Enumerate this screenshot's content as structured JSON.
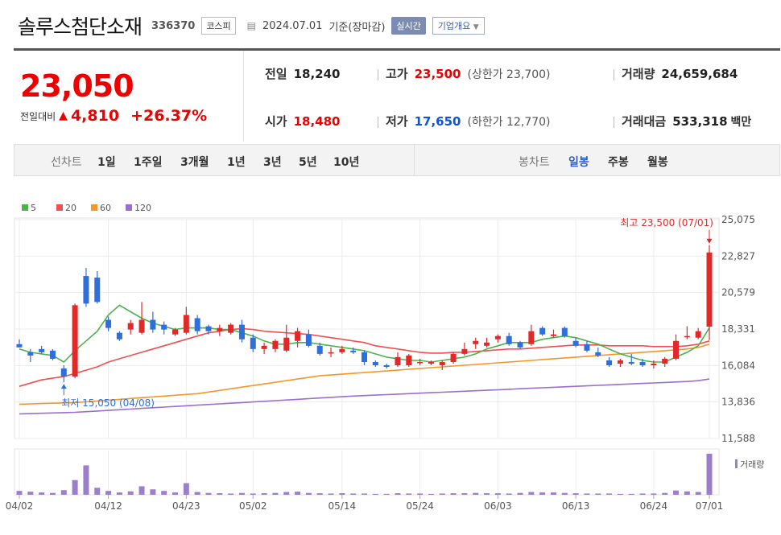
{
  "header": {
    "name": "솔루스첨단소재",
    "code": "336370",
    "market": "코스피",
    "date": "2024.07.01",
    "basis": "기준(장마감)",
    "realtime": "실시간",
    "corp_info": "기업개요"
  },
  "quote": {
    "price": "23,050",
    "change_label": "전일대비",
    "change": "4,810",
    "change_pct": "+26.37%",
    "prev_label": "전일",
    "prev": "18,240",
    "open_label": "시가",
    "open": "18,480",
    "high_label": "고가",
    "high": "23,500",
    "upper_limit": "(상한가 23,700)",
    "low_label": "저가",
    "low": "17,650",
    "lower_limit": "(하한가 12,770)",
    "volume_label": "거래량",
    "volume": "24,659,684",
    "amount_label": "거래대금",
    "amount": "533,318",
    "amount_unit": "백만"
  },
  "tabs": {
    "line_chart": "선차트",
    "periods": [
      "1일",
      "1주일",
      "3개월",
      "1년",
      "3년",
      "5년",
      "10년"
    ],
    "candle_chart": "봉차트",
    "candle_types": [
      "일봉",
      "주봉",
      "월봉"
    ]
  },
  "chart_data": {
    "type": "candlestick",
    "legend": [
      "5",
      "20",
      "60",
      "120"
    ],
    "legend_colors": [
      "#4cb34c",
      "#f05050",
      "#f5962a",
      "#9b6ed0"
    ],
    "y_ticks": [
      25075,
      22827,
      20579,
      18331,
      16084,
      13836,
      11588
    ],
    "ylim": [
      11588,
      25075
    ],
    "x_ticks": [
      "04/02",
      "04/12",
      "04/23",
      "05/02",
      "05/14",
      "05/24",
      "06/03",
      "06/13",
      "06/24",
      "07/01"
    ],
    "x_tick_index": [
      0,
      8,
      15,
      21,
      29,
      36,
      43,
      50,
      57,
      62
    ],
    "high_annotation": "최고 23,500 (07/01)",
    "low_annotation": "최저 15,050 (04/08)",
    "volume_label": "거래량",
    "candles": [
      {
        "o": 17400,
        "h": 17700,
        "l": 17200,
        "c": 17200
      },
      {
        "o": 16900,
        "h": 17100,
        "l": 16300,
        "c": 16700
      },
      {
        "o": 17100,
        "h": 17300,
        "l": 16800,
        "c": 16900
      },
      {
        "o": 17000,
        "h": 17100,
        "l": 16400,
        "c": 16500
      },
      {
        "o": 15900,
        "h": 16100,
        "l": 15050,
        "c": 15400
      },
      {
        "o": 15400,
        "h": 19900,
        "l": 15300,
        "c": 19800
      },
      {
        "o": 21600,
        "h": 22100,
        "l": 19700,
        "c": 19900
      },
      {
        "o": 21500,
        "h": 21900,
        "l": 19900,
        "c": 20000
      },
      {
        "o": 18900,
        "h": 19100,
        "l": 18200,
        "c": 18400
      },
      {
        "o": 18100,
        "h": 18200,
        "l": 17600,
        "c": 17700
      },
      {
        "o": 18300,
        "h": 18900,
        "l": 18000,
        "c": 18700
      },
      {
        "o": 18100,
        "h": 20000,
        "l": 18000,
        "c": 18900
      },
      {
        "o": 18900,
        "h": 19400,
        "l": 18100,
        "c": 18300
      },
      {
        "o": 18600,
        "h": 18800,
        "l": 18000,
        "c": 18300
      },
      {
        "o": 18000,
        "h": 18400,
        "l": 17900,
        "c": 18300
      },
      {
        "o": 18100,
        "h": 19700,
        "l": 18000,
        "c": 19200
      },
      {
        "o": 19000,
        "h": 19200,
        "l": 18000,
        "c": 18200
      },
      {
        "o": 18500,
        "h": 18600,
        "l": 18000,
        "c": 18200
      },
      {
        "o": 18200,
        "h": 18600,
        "l": 17900,
        "c": 18400
      },
      {
        "o": 18100,
        "h": 18700,
        "l": 18000,
        "c": 18600
      },
      {
        "o": 18600,
        "h": 18900,
        "l": 17500,
        "c": 17700
      },
      {
        "o": 17800,
        "h": 18000,
        "l": 16900,
        "c": 17100
      },
      {
        "o": 17100,
        "h": 17500,
        "l": 16800,
        "c": 17300
      },
      {
        "o": 17100,
        "h": 17700,
        "l": 16900,
        "c": 17600
      },
      {
        "o": 17000,
        "h": 18600,
        "l": 16900,
        "c": 17800
      },
      {
        "o": 17600,
        "h": 18400,
        "l": 17200,
        "c": 18200
      },
      {
        "o": 18000,
        "h": 18300,
        "l": 17200,
        "c": 17300
      },
      {
        "o": 17300,
        "h": 17500,
        "l": 16700,
        "c": 16800
      },
      {
        "o": 16900,
        "h": 17200,
        "l": 16600,
        "c": 16900
      },
      {
        "o": 16900,
        "h": 17300,
        "l": 16800,
        "c": 17100
      },
      {
        "o": 17000,
        "h": 17200,
        "l": 16800,
        "c": 16900
      },
      {
        "o": 16900,
        "h": 17000,
        "l": 16100,
        "c": 16300
      },
      {
        "o": 16300,
        "h": 16400,
        "l": 16000,
        "c": 16100
      },
      {
        "o": 16100,
        "h": 16200,
        "l": 15900,
        "c": 16000
      },
      {
        "o": 16100,
        "h": 16900,
        "l": 16000,
        "c": 16600
      },
      {
        "o": 16100,
        "h": 16800,
        "l": 16000,
        "c": 16700
      },
      {
        "o": 16300,
        "h": 16500,
        "l": 16100,
        "c": 16300
      },
      {
        "o": 16200,
        "h": 16400,
        "l": 16100,
        "c": 16300
      },
      {
        "o": 16100,
        "h": 16400,
        "l": 15800,
        "c": 16300
      },
      {
        "o": 16300,
        "h": 16900,
        "l": 16200,
        "c": 16800
      },
      {
        "o": 16800,
        "h": 17500,
        "l": 16700,
        "c": 17100
      },
      {
        "o": 17400,
        "h": 17800,
        "l": 17100,
        "c": 17600
      },
      {
        "o": 17300,
        "h": 17800,
        "l": 17200,
        "c": 17500
      },
      {
        "o": 17700,
        "h": 18000,
        "l": 17500,
        "c": 17900
      },
      {
        "o": 17900,
        "h": 18100,
        "l": 17300,
        "c": 17400
      },
      {
        "o": 17500,
        "h": 17600,
        "l": 17100,
        "c": 17200
      },
      {
        "o": 17400,
        "h": 18600,
        "l": 17300,
        "c": 18200
      },
      {
        "o": 18400,
        "h": 18500,
        "l": 17900,
        "c": 18000
      },
      {
        "o": 17900,
        "h": 18300,
        "l": 17800,
        "c": 18000
      },
      {
        "o": 18400,
        "h": 18500,
        "l": 17800,
        "c": 17900
      },
      {
        "o": 17600,
        "h": 17800,
        "l": 17200,
        "c": 17300
      },
      {
        "o": 17400,
        "h": 17600,
        "l": 16900,
        "c": 17000
      },
      {
        "o": 16900,
        "h": 17200,
        "l": 16600,
        "c": 16700
      },
      {
        "o": 16400,
        "h": 16600,
        "l": 16000,
        "c": 16100
      },
      {
        "o": 16200,
        "h": 16500,
        "l": 16000,
        "c": 16400
      },
      {
        "o": 16300,
        "h": 16800,
        "l": 16100,
        "c": 16200
      },
      {
        "o": 16300,
        "h": 16500,
        "l": 16000,
        "c": 16100
      },
      {
        "o": 16100,
        "h": 16400,
        "l": 15900,
        "c": 16200
      },
      {
        "o": 16200,
        "h": 16600,
        "l": 16000,
        "c": 16500
      },
      {
        "o": 16500,
        "h": 18000,
        "l": 16400,
        "c": 17600
      },
      {
        "o": 17900,
        "h": 18500,
        "l": 17700,
        "c": 17900
      },
      {
        "o": 17800,
        "h": 18400,
        "l": 17700,
        "c": 18200
      },
      {
        "o": 18480,
        "h": 23500,
        "l": 17650,
        "c": 23050
      }
    ],
    "ma5": [
      17100,
      16900,
      16800,
      16700,
      16300,
      17000,
      17600,
      18200,
      19200,
      19800,
      19400,
      19000,
      18700,
      18500,
      18300,
      18400,
      18400,
      18400,
      18300,
      18300,
      18100,
      17900,
      17600,
      17400,
      17400,
      17500,
      17500,
      17400,
      17300,
      17200,
      17100,
      17000,
      16800,
      16600,
      16500,
      16400,
      16400,
      16300,
      16400,
      16500,
      16600,
      16800,
      17100,
      17300,
      17500,
      17500,
      17500,
      17700,
      17800,
      17900,
      17800,
      17600,
      17400,
      17100,
      16800,
      16600,
      16400,
      16300,
      16300,
      16600,
      16900,
      17300,
      18400
    ],
    "ma20": [
      14800,
      15000,
      15200,
      15300,
      15400,
      15600,
      15800,
      16000,
      16300,
      16500,
      16700,
      16900,
      17100,
      17300,
      17500,
      17700,
      17900,
      18100,
      18200,
      18300,
      18350,
      18300,
      18200,
      18150,
      18100,
      18050,
      18000,
      17900,
      17800,
      17700,
      17600,
      17500,
      17300,
      17200,
      17100,
      17000,
      16900,
      16850,
      16850,
      16900,
      16900,
      16950,
      17000,
      17050,
      17100,
      17100,
      17150,
      17200,
      17250,
      17300,
      17350,
      17350,
      17350,
      17300,
      17300,
      17300,
      17300,
      17250,
      17250,
      17250,
      17300,
      17400,
      17600
    ],
    "ma60": [
      13700,
      13720,
      13740,
      13760,
      13780,
      13800,
      13850,
      13900,
      13950,
      14000,
      14050,
      14100,
      14150,
      14200,
      14250,
      14300,
      14350,
      14450,
      14550,
      14650,
      14750,
      14850,
      14950,
      15050,
      15150,
      15250,
      15350,
      15450,
      15500,
      15550,
      15600,
      15650,
      15700,
      15750,
      15800,
      15850,
      15900,
      15950,
      16000,
      16050,
      16100,
      16150,
      16200,
      16250,
      16300,
      16350,
      16400,
      16450,
      16500,
      16550,
      16600,
      16650,
      16700,
      16750,
      16800,
      16850,
      16900,
      16950,
      17000,
      17050,
      17100,
      17200,
      17400
    ],
    "ma120": [
      13100,
      13120,
      13140,
      13160,
      13180,
      13200,
      13240,
      13280,
      13320,
      13360,
      13400,
      13440,
      13480,
      13520,
      13560,
      13600,
      13640,
      13680,
      13720,
      13760,
      13800,
      13840,
      13880,
      13920,
      13960,
      14000,
      14040,
      14080,
      14120,
      14160,
      14200,
      14230,
      14260,
      14290,
      14320,
      14350,
      14380,
      14410,
      14440,
      14470,
      14500,
      14530,
      14560,
      14590,
      14620,
      14650,
      14680,
      14710,
      14740,
      14770,
      14800,
      14830,
      14860,
      14890,
      14920,
      14950,
      14980,
      15010,
      15040,
      15070,
      15100,
      15150,
      15250
    ],
    "volume": [
      0.25,
      0.2,
      0.15,
      0.12,
      0.3,
      0.95,
      1.9,
      0.45,
      0.25,
      0.15,
      0.22,
      0.55,
      0.35,
      0.25,
      0.15,
      0.75,
      0.18,
      0.12,
      0.1,
      0.08,
      0.12,
      0.08,
      0.1,
      0.12,
      0.18,
      0.2,
      0.12,
      0.1,
      0.08,
      0.1,
      0.08,
      0.08,
      0.06,
      0.06,
      0.1,
      0.08,
      0.08,
      0.06,
      0.08,
      0.1,
      0.1,
      0.12,
      0.1,
      0.1,
      0.08,
      0.12,
      0.18,
      0.15,
      0.15,
      0.12,
      0.1,
      0.08,
      0.08,
      0.08,
      0.06,
      0.06,
      0.08,
      0.08,
      0.12,
      0.28,
      0.22,
      0.18,
      2.65
    ]
  }
}
